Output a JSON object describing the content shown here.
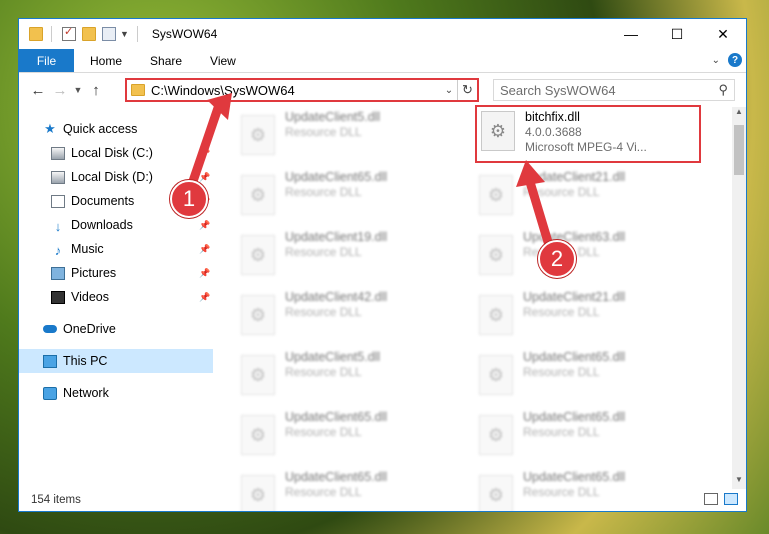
{
  "window": {
    "title": "SysWOW64",
    "controls": {
      "minimize": "—",
      "maximize": "☐",
      "close": "✕"
    }
  },
  "ribbon": {
    "tabs": [
      "File",
      "Home",
      "Share",
      "View"
    ],
    "help": "?"
  },
  "address": {
    "path": "C:\\Windows\\SysWOW64",
    "search_placeholder": "Search SysWOW64"
  },
  "nav": {
    "quick_access": "Quick access",
    "items": [
      {
        "label": "Local Disk (C:)",
        "icon": "drive-icon",
        "pinned": true
      },
      {
        "label": "Local Disk (D:)",
        "icon": "drive-icon",
        "pinned": true
      },
      {
        "label": "Documents",
        "icon": "documents-icon",
        "pinned": true
      },
      {
        "label": "Downloads",
        "icon": "downloads-icon",
        "pinned": true
      },
      {
        "label": "Music",
        "icon": "music-icon",
        "pinned": true
      },
      {
        "label": "Pictures",
        "icon": "pictures-icon",
        "pinned": true
      },
      {
        "label": "Videos",
        "icon": "videos-icon",
        "pinned": true
      }
    ],
    "onedrive": "OneDrive",
    "this_pc": "This PC",
    "network": "Network"
  },
  "files": {
    "left_column": [
      {
        "name": "UpdateClient5.dll",
        "type": "Resource DLL"
      },
      {
        "name": "UpdateClient65.dll",
        "type": "Resource DLL"
      },
      {
        "name": "UpdateClient19.dll",
        "type": "Resource DLL"
      },
      {
        "name": "UpdateClient42.dll",
        "type": "Resource DLL"
      },
      {
        "name": "UpdateClient5.dll",
        "type": "Resource DLL"
      },
      {
        "name": "UpdateClient65.dll",
        "type": "Resource DLL"
      },
      {
        "name": "UpdateClient65.dll",
        "type": "Resource DLL"
      }
    ],
    "highlighted": {
      "name": "bitchfix.dll",
      "version": "4.0.0.3688",
      "description": "Microsoft MPEG-4 Vi..."
    },
    "right_column": [
      {
        "name": "UpdateClient21.dll",
        "type": "Resource DLL"
      },
      {
        "name": "UpdateClient63.dll",
        "type": "Resource DLL"
      },
      {
        "name": "UpdateClient21.dll",
        "type": "Resource DLL"
      },
      {
        "name": "UpdateClient65.dll",
        "type": "Resource DLL"
      },
      {
        "name": "UpdateClient65.dll",
        "type": "Resource DLL"
      },
      {
        "name": "UpdateClient65.dll",
        "type": "Resource DLL"
      }
    ]
  },
  "status": {
    "count": "154 items"
  },
  "annotations": {
    "step1": "1",
    "step2": "2",
    "accent": "#e0393e"
  }
}
